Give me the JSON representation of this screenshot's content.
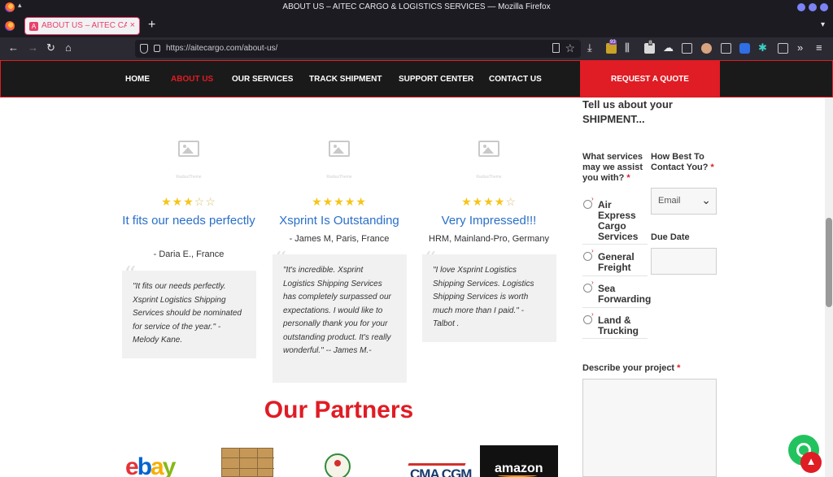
{
  "window": {
    "title": "ABOUT US – AITEC CARGO & LOGISTICS SERVICES — Mozilla Firefox"
  },
  "tab": {
    "label": "ABOUT US – AITEC CARGO",
    "close": "×",
    "new_tab": "+"
  },
  "urlbar": {
    "url": "https://aitecargo.com/about-us/"
  },
  "toolbar": {
    "badge_count": "93",
    "badge_small": "8"
  },
  "nav": {
    "items": [
      "HOME",
      "ABOUT US",
      "OUR SERVICES",
      "TRACK SHIPMENT",
      "SUPPORT CENTER",
      "CONTACT US"
    ],
    "active_index": 1,
    "cta": "REQUEST A QUOTE",
    "accent": "#e01c24"
  },
  "testimonials": [
    {
      "watermark": "RadiusTheme",
      "rating": 3,
      "title": "It fits our needs perfectly",
      "author": "- Daria E., France",
      "quote": "\"It fits our needs perfectly. Xsprint Logistics Shipping Services should be nominated for service of the year.\" - Melody Kane."
    },
    {
      "watermark": "RadiusTheme",
      "rating": 5,
      "title": "Xsprint Is Outstanding",
      "author": "- James M, Paris, France",
      "quote": "\"It's incredible. Xsprint Logistics Shipping Services has completely surpassed our expectations. I would like to personally thank you for your outstanding product. It's really wonderful.\" -- James M.-"
    },
    {
      "watermark": "RadiusTheme",
      "rating": 4,
      "title": "Very Impressed!!!",
      "author": "HRM, Mainland-Pro, Germany",
      "quote": "\"I love Xsprint Logistics Shipping Services.  Logistics Shipping Services is worth much more than I paid.\" - Talbot ."
    }
  ],
  "partners": {
    "title": "Our Partners",
    "logos": [
      "ebay",
      "CMA CGM",
      "amazon"
    ]
  },
  "form": {
    "heading_line1": "Tell us about your",
    "heading_line2": "SHIPMENT...",
    "services_question": "What services may we assist you with?",
    "required_mark": "*",
    "services": [
      "Air Express Cargo Services",
      "General Freight",
      "Sea Forwarding",
      "Land & Trucking"
    ],
    "contact_question": "How Best To Contact You?",
    "contact_selected": "Email",
    "due_date_label": "Due Date",
    "project_label": "Describe your project"
  }
}
